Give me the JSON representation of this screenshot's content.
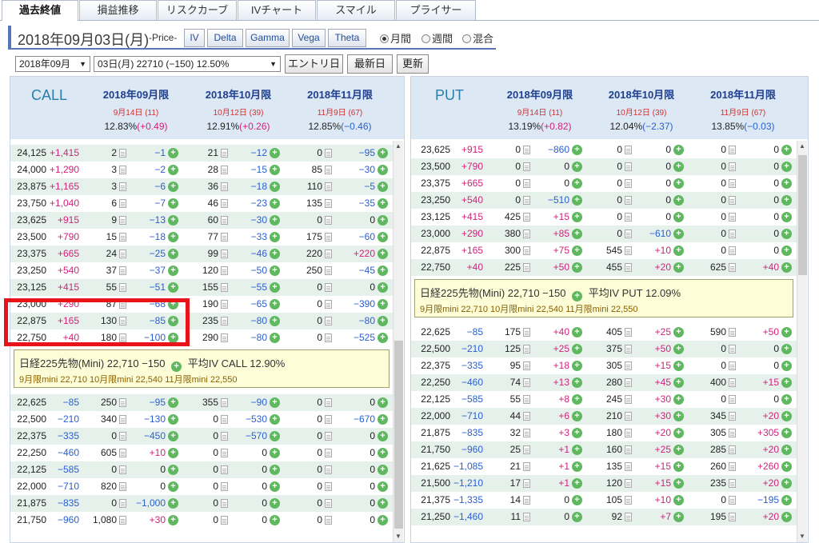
{
  "tabs": [
    "過去終値",
    "損益推移",
    "リスクカーブ",
    "IVチャート",
    "スマイル",
    "プライサー"
  ],
  "title": "2018年09月03日(月)",
  "price_label": "-Price-",
  "price_buttons": [
    "IV",
    "Delta",
    "Gamma",
    "Vega",
    "Theta"
  ],
  "radios": [
    {
      "label": "月間",
      "selected": true
    },
    {
      "label": "週間",
      "selected": false
    },
    {
      "label": "混合",
      "selected": false
    }
  ],
  "month_select": "2018年09月",
  "day_select": "03日(月) 22710 (−150) 12.50%",
  "action_buttons": [
    "エントリ日",
    "最新日",
    "更新"
  ],
  "call": {
    "label": "CALL",
    "months": [
      {
        "month": "2018年09月限",
        "date": "9月14日 (11)",
        "iv": "12.83%",
        "chg": "(+0.49)"
      },
      {
        "month": "2018年10月限",
        "date": "10月12日 (39)",
        "iv": "12.91%",
        "chg": "(+0.26)"
      },
      {
        "month": "2018年11月限",
        "date": "11月9日 (67)",
        "iv": "12.85%",
        "chg": "(−0.46)"
      }
    ],
    "rows_above": [
      [
        "24,125",
        "+1,415",
        "2",
        "−1",
        "21",
        "−12",
        "0",
        "−95"
      ],
      [
        "24,000",
        "+1,290",
        "3",
        "−2",
        "28",
        "−15",
        "85",
        "−30"
      ],
      [
        "23,875",
        "+1,165",
        "3",
        "−6",
        "36",
        "−18",
        "110",
        "−5"
      ],
      [
        "23,750",
        "+1,040",
        "6",
        "−7",
        "46",
        "−23",
        "135",
        "−35"
      ],
      [
        "23,625",
        "+915",
        "9",
        "−13",
        "60",
        "−30",
        "0",
        "0"
      ],
      [
        "23,500",
        "+790",
        "15",
        "−18",
        "77",
        "−33",
        "175",
        "−60"
      ],
      [
        "23,375",
        "+665",
        "24",
        "−25",
        "99",
        "−46",
        "220",
        "+220"
      ],
      [
        "23,250",
        "+540",
        "37",
        "−37",
        "120",
        "−50",
        "250",
        "−45"
      ],
      [
        "23,125",
        "+415",
        "55",
        "−51",
        "155",
        "−55",
        "0",
        "0"
      ],
      [
        "23,000",
        "+290",
        "87",
        "−68",
        "190",
        "−65",
        "0",
        "−390"
      ],
      [
        "22,875",
        "+165",
        "130",
        "−85",
        "235",
        "−80",
        "0",
        "−80"
      ],
      [
        "22,750",
        "+40",
        "180",
        "−100",
        "290",
        "−80",
        "0",
        "−525"
      ]
    ],
    "future": {
      "line1": "日経225先物(Mini) 22,710 −150",
      "iv": "平均IV CALL 12.90%",
      "line2": "9月限mini 22,710  10月限mini 22,540  11月限mini 22,550"
    },
    "rows_below": [
      [
        "22,625",
        "−85",
        "250",
        "−95",
        "355",
        "−90",
        "0",
        "0"
      ],
      [
        "22,500",
        "−210",
        "340",
        "−130",
        "0",
        "−530",
        "0",
        "−670"
      ],
      [
        "22,375",
        "−335",
        "0",
        "−450",
        "0",
        "−570",
        "0",
        "0"
      ],
      [
        "22,250",
        "−460",
        "605",
        "+10",
        "0",
        "0",
        "0",
        "0"
      ],
      [
        "22,125",
        "−585",
        "0",
        "0",
        "0",
        "0",
        "0",
        "0"
      ],
      [
        "22,000",
        "−710",
        "820",
        "0",
        "0",
        "0",
        "0",
        "0"
      ],
      [
        "21,875",
        "−835",
        "0",
        "−1,000",
        "0",
        "0",
        "0",
        "0"
      ],
      [
        "21,750",
        "−960",
        "1,080",
        "+30",
        "0",
        "0",
        "0",
        "0"
      ]
    ]
  },
  "put": {
    "label": "PUT",
    "months": [
      {
        "month": "2018年09月限",
        "date": "9月14日 (11)",
        "iv": "13.19%",
        "chg": "(+0.82)"
      },
      {
        "month": "2018年10月限",
        "date": "10月12日 (39)",
        "iv": "12.04%",
        "chg": "(−2.37)"
      },
      {
        "month": "2018年11月限",
        "date": "11月9日 (67)",
        "iv": "13.85%",
        "chg": "(−0.03)"
      }
    ],
    "rows_above": [
      [
        "23,625",
        "+915",
        "0",
        "−860",
        "0",
        "0",
        "0",
        "0"
      ],
      [
        "23,500",
        "+790",
        "0",
        "0",
        "0",
        "0",
        "0",
        "0"
      ],
      [
        "23,375",
        "+665",
        "0",
        "0",
        "0",
        "0",
        "0",
        "0"
      ],
      [
        "23,250",
        "+540",
        "0",
        "−510",
        "0",
        "0",
        "0",
        "0"
      ],
      [
        "23,125",
        "+415",
        "425",
        "+15",
        "0",
        "0",
        "0",
        "0"
      ],
      [
        "23,000",
        "+290",
        "380",
        "+85",
        "0",
        "−610",
        "0",
        "0"
      ],
      [
        "22,875",
        "+165",
        "300",
        "+75",
        "545",
        "+10",
        "0",
        "0"
      ],
      [
        "22,750",
        "+40",
        "225",
        "+50",
        "455",
        "+20",
        "625",
        "+40"
      ]
    ],
    "future": {
      "line1": "日経225先物(Mini) 22,710 −150",
      "iv": "平均IV PUT 12.09%",
      "line2": "9月限mini 22,710  10月限mini 22,540  11月限mini 22,550"
    },
    "rows_below": [
      [
        "22,625",
        "−85",
        "175",
        "+40",
        "405",
        "+25",
        "590",
        "+50"
      ],
      [
        "22,500",
        "−210",
        "125",
        "+25",
        "375",
        "+50",
        "0",
        "0"
      ],
      [
        "22,375",
        "−335",
        "95",
        "+18",
        "305",
        "+15",
        "0",
        "0"
      ],
      [
        "22,250",
        "−460",
        "74",
        "+13",
        "280",
        "+45",
        "400",
        "+15"
      ],
      [
        "22,125",
        "−585",
        "55",
        "+8",
        "245",
        "+30",
        "0",
        "0"
      ],
      [
        "22,000",
        "−710",
        "44",
        "+6",
        "210",
        "+30",
        "345",
        "+20"
      ],
      [
        "21,875",
        "−835",
        "32",
        "+3",
        "180",
        "+20",
        "305",
        "+305"
      ],
      [
        "21,750",
        "−960",
        "25",
        "+1",
        "160",
        "+25",
        "285",
        "+20"
      ],
      [
        "21,625",
        "−1,085",
        "21",
        "+1",
        "135",
        "+15",
        "260",
        "+260"
      ],
      [
        "21,500",
        "−1,210",
        "17",
        "+1",
        "120",
        "+15",
        "235",
        "+20"
      ],
      [
        "21,375",
        "−1,335",
        "14",
        "0",
        "105",
        "+10",
        "0",
        "−195"
      ],
      [
        "21,250",
        "−1,460",
        "11",
        "0",
        "92",
        "+7",
        "195",
        "+20"
      ]
    ]
  }
}
